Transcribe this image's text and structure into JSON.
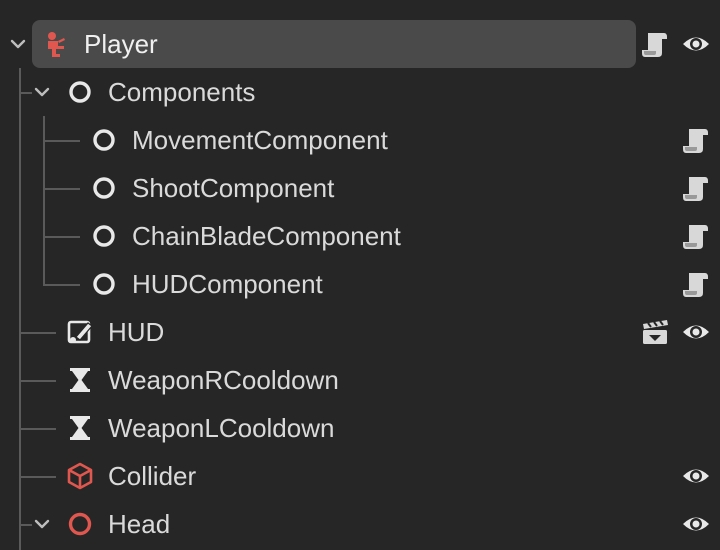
{
  "scene_tree": {
    "nodes": [
      {
        "label": "Player",
        "icon": "character-body-icon",
        "selected": true,
        "expanded": true,
        "has_script": true,
        "visible": true
      },
      {
        "label": "Components",
        "icon": "node-circle-icon",
        "expanded": true
      },
      {
        "label": "MovementComponent",
        "icon": "node-circle-icon",
        "has_script": true
      },
      {
        "label": "ShootComponent",
        "icon": "node-circle-icon",
        "has_script": true
      },
      {
        "label": "ChainBladeComponent",
        "icon": "node-circle-icon",
        "has_script": true
      },
      {
        "label": "HUDComponent",
        "icon": "node-circle-icon",
        "has_script": true
      },
      {
        "label": "HUD",
        "icon": "control-edit-icon",
        "has_scene": true,
        "visible": true
      },
      {
        "label": "WeaponRCooldown",
        "icon": "timer-hourglass-icon"
      },
      {
        "label": "WeaponLCooldown",
        "icon": "timer-hourglass-icon"
      },
      {
        "label": "Collider",
        "icon": "collision-shape-cube-icon",
        "visible": true
      },
      {
        "label": "Head",
        "icon": "node-circle-red-icon",
        "expanded": true,
        "visible": true
      }
    ]
  },
  "colors": {
    "background": "#262626",
    "selection": "#4a4a4a",
    "text": "#dadada",
    "icon_red": "#e0574f",
    "icon_white": "#e8e8e8",
    "guide_line": "#5a5a5a"
  }
}
